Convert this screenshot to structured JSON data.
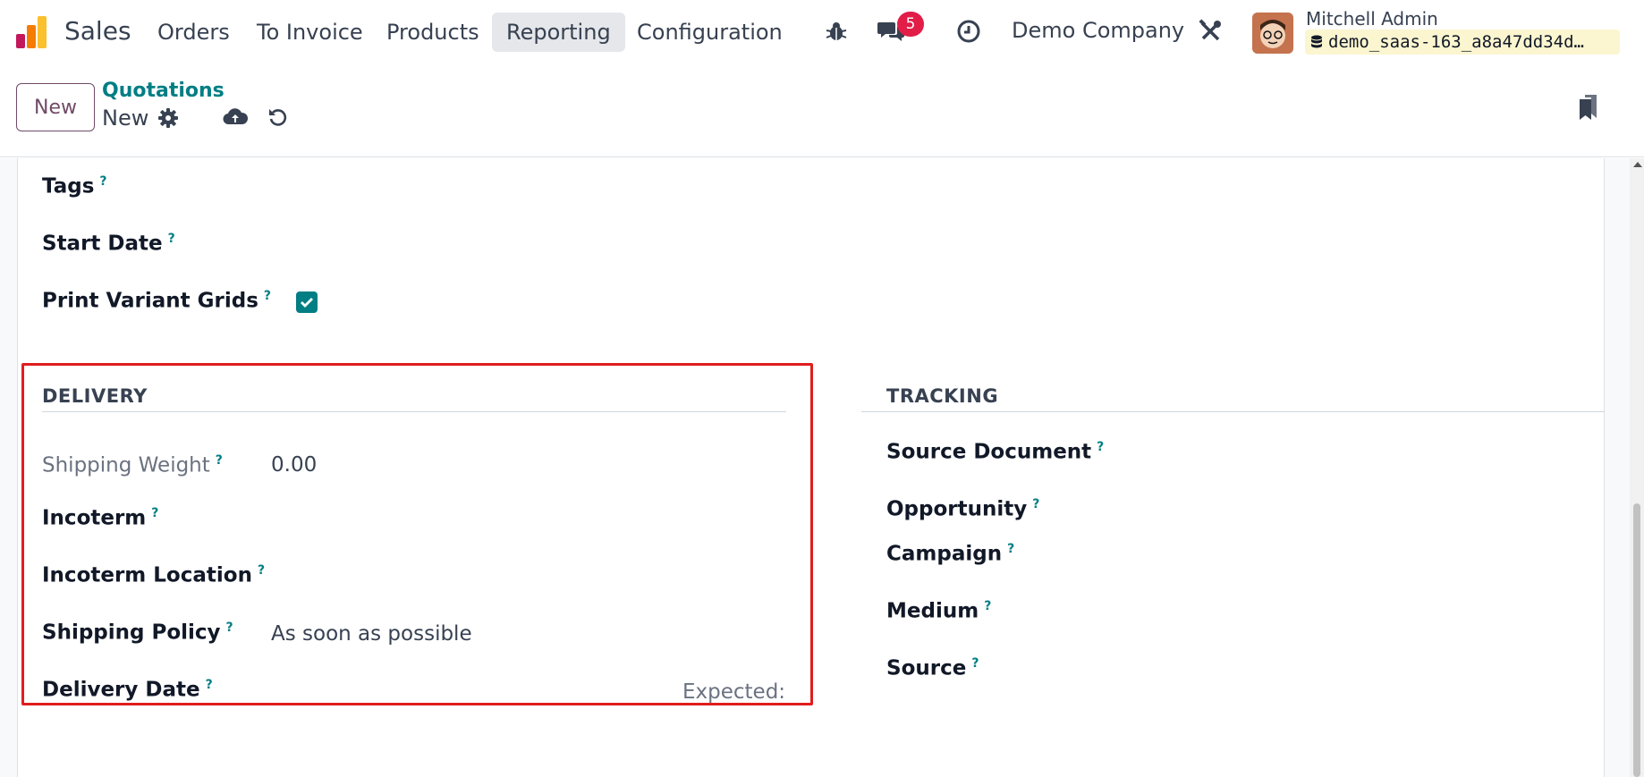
{
  "navbar": {
    "app_name": "Sales",
    "menu": [
      "Orders",
      "To Invoice",
      "Products",
      "Reporting",
      "Configuration"
    ],
    "active_menu": "Reporting",
    "messages_badge": "5",
    "company": "Demo Company",
    "user_name": "Mitchell Admin",
    "database": "demo_saas-163_a8a47dd34d…"
  },
  "control": {
    "new_button": "New",
    "breadcrumb_parent": "Quotations",
    "breadcrumb_current": "New"
  },
  "top_fields": {
    "tags_label": "Tags",
    "start_date_label": "Start Date",
    "print_variant_grids_label": "Print Variant Grids",
    "print_variant_grids_checked": true
  },
  "delivery": {
    "title": "DELIVERY",
    "shipping_weight_label": "Shipping Weight",
    "shipping_weight_value": "0.00",
    "incoterm_label": "Incoterm",
    "incoterm_location_label": "Incoterm Location",
    "shipping_policy_label": "Shipping Policy",
    "shipping_policy_value": "As soon as possible",
    "delivery_date_label": "Delivery Date",
    "expected_label": "Expected:"
  },
  "tracking": {
    "title": "TRACKING",
    "source_document_label": "Source Document",
    "opportunity_label": "Opportunity",
    "campaign_label": "Campaign",
    "medium_label": "Medium",
    "source_label": "Source"
  },
  "help_marker": "?",
  "colors": {
    "brand": "#714b67",
    "accent": "#017e84",
    "badge": "#e11d48",
    "highlight": "#e11d1d"
  },
  "icons": [
    "app-logo-icon",
    "bug-icon",
    "chat-icon",
    "clock-icon",
    "tools-icon",
    "database-icon",
    "gear-icon",
    "cloud-upload-icon",
    "undo-icon",
    "bookmark-icon",
    "check-icon"
  ]
}
